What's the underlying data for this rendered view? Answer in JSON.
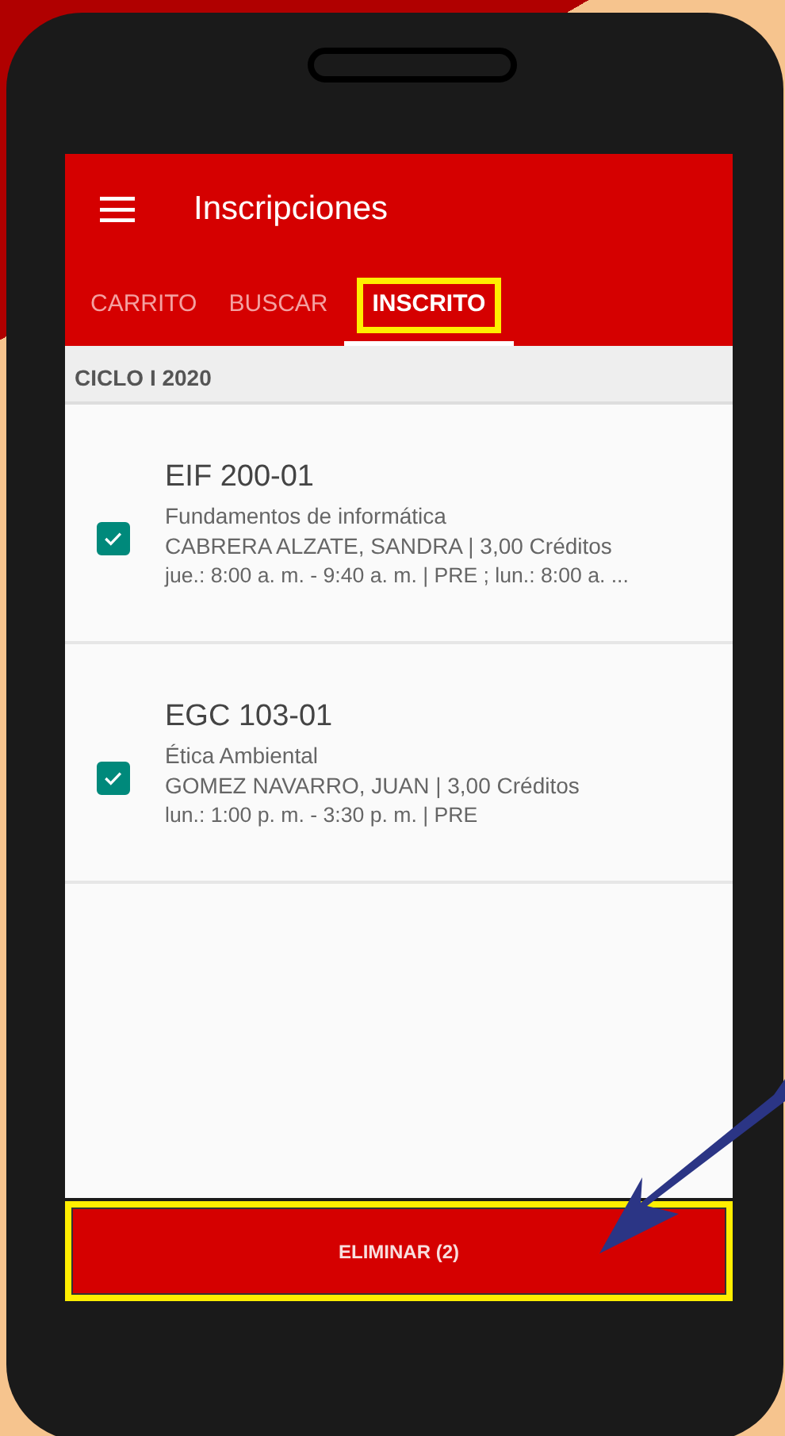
{
  "app_bar": {
    "title": "Inscripciones"
  },
  "tabs": [
    {
      "label": "CARRITO",
      "selected": false,
      "highlighted": false
    },
    {
      "label": "BUSCAR",
      "selected": false,
      "highlighted": false
    },
    {
      "label": "INSCRITO",
      "selected": true,
      "highlighted": true
    }
  ],
  "section": {
    "title": "CICLO I 2020"
  },
  "courses": [
    {
      "code": "EIF 200-01",
      "name": "Fundamentos de informática",
      "instructor_credits": "CABRERA ALZATE, SANDRA | 3,00 Créditos",
      "schedule": "jue.: 8:00 a. m. - 9:40 a. m. | PRE ; lun.: 8:00 a. ...",
      "checked": true
    },
    {
      "code": "EGC 103-01",
      "name": "Ética Ambiental",
      "instructor_credits": "GOMEZ NAVARRO, JUAN | 3,00 Créditos",
      "schedule": "lun.: 1:00 p. m. - 3:30 p. m. | PRE",
      "checked": true
    }
  ],
  "action_button": {
    "label": "ELIMINAR (2)",
    "highlighted": true
  }
}
